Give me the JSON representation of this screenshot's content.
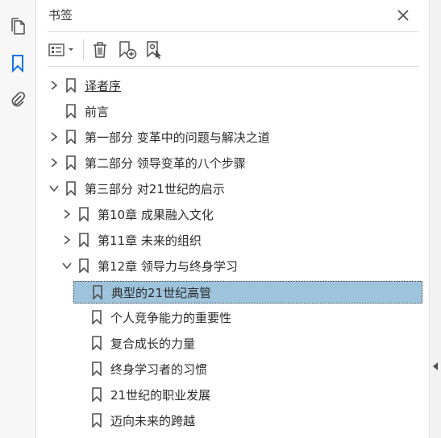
{
  "panel": {
    "title": "书签"
  },
  "rail": {
    "items": [
      {
        "name": "pages-icon"
      },
      {
        "name": "bookmarks-icon"
      },
      {
        "name": "attachments-icon"
      }
    ]
  },
  "bookmarks": [
    {
      "label": "译者序",
      "level": 0,
      "state": "collapsed",
      "selected": false,
      "underline": true
    },
    {
      "label": "前言",
      "level": 0,
      "state": "leaf",
      "selected": false,
      "underline": false
    },
    {
      "label": "第一部分 变革中的问题与解决之道",
      "level": 0,
      "state": "collapsed",
      "selected": false,
      "underline": false
    },
    {
      "label": "第二部分 领导变革的八个步骤",
      "level": 0,
      "state": "collapsed",
      "selected": false,
      "underline": false
    },
    {
      "label": "第三部分 对21世纪的启示",
      "level": 0,
      "state": "expanded",
      "selected": false,
      "underline": false
    },
    {
      "label": "第10章 成果融入文化",
      "level": 1,
      "state": "collapsed",
      "selected": false,
      "underline": false
    },
    {
      "label": "第11章 未来的组织",
      "level": 1,
      "state": "collapsed",
      "selected": false,
      "underline": false
    },
    {
      "label": "第12章 领导力与终身学习",
      "level": 1,
      "state": "expanded",
      "selected": false,
      "underline": false
    },
    {
      "label": "典型的21世纪高管",
      "level": 2,
      "state": "leaf",
      "selected": true,
      "underline": false
    },
    {
      "label": "个人竞争能力的重要性",
      "level": 2,
      "state": "leaf",
      "selected": false,
      "underline": false
    },
    {
      "label": "复合成长的力量",
      "level": 2,
      "state": "leaf",
      "selected": false,
      "underline": false
    },
    {
      "label": "终身学习者的习惯",
      "level": 2,
      "state": "leaf",
      "selected": false,
      "underline": false
    },
    {
      "label": "21世纪的职业发展",
      "level": 2,
      "state": "leaf",
      "selected": false,
      "underline": false
    },
    {
      "label": "迈向未来的跨越",
      "level": 2,
      "state": "leaf",
      "selected": false,
      "underline": false
    }
  ],
  "colors": {
    "accent": "#1473e6",
    "selected_bg": "#9dc3dd",
    "icon": "#505050"
  }
}
